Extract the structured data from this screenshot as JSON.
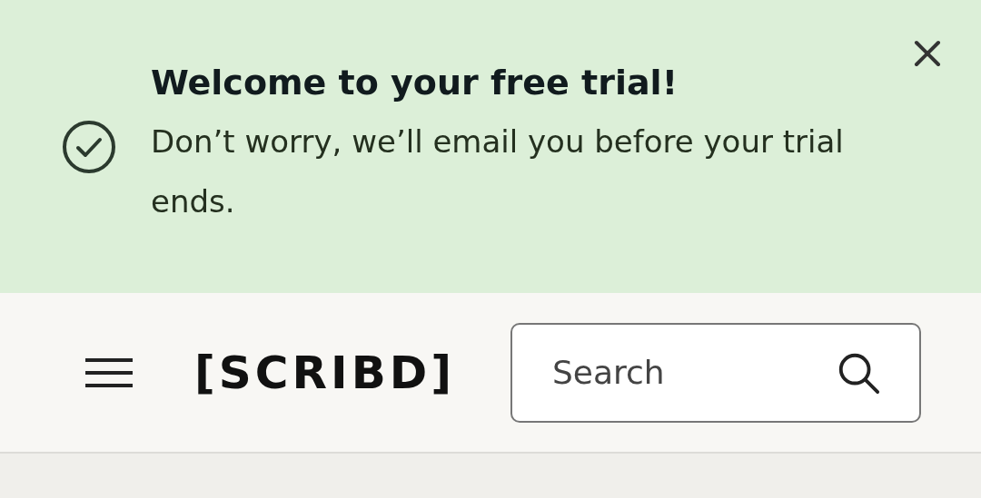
{
  "banner": {
    "title": "Welcome to your free trial!",
    "message": "Don’t worry, we’ll email you before your trial ends."
  },
  "header": {
    "logo": "[SCRIBD]",
    "search": {
      "placeholder": "Search"
    }
  }
}
